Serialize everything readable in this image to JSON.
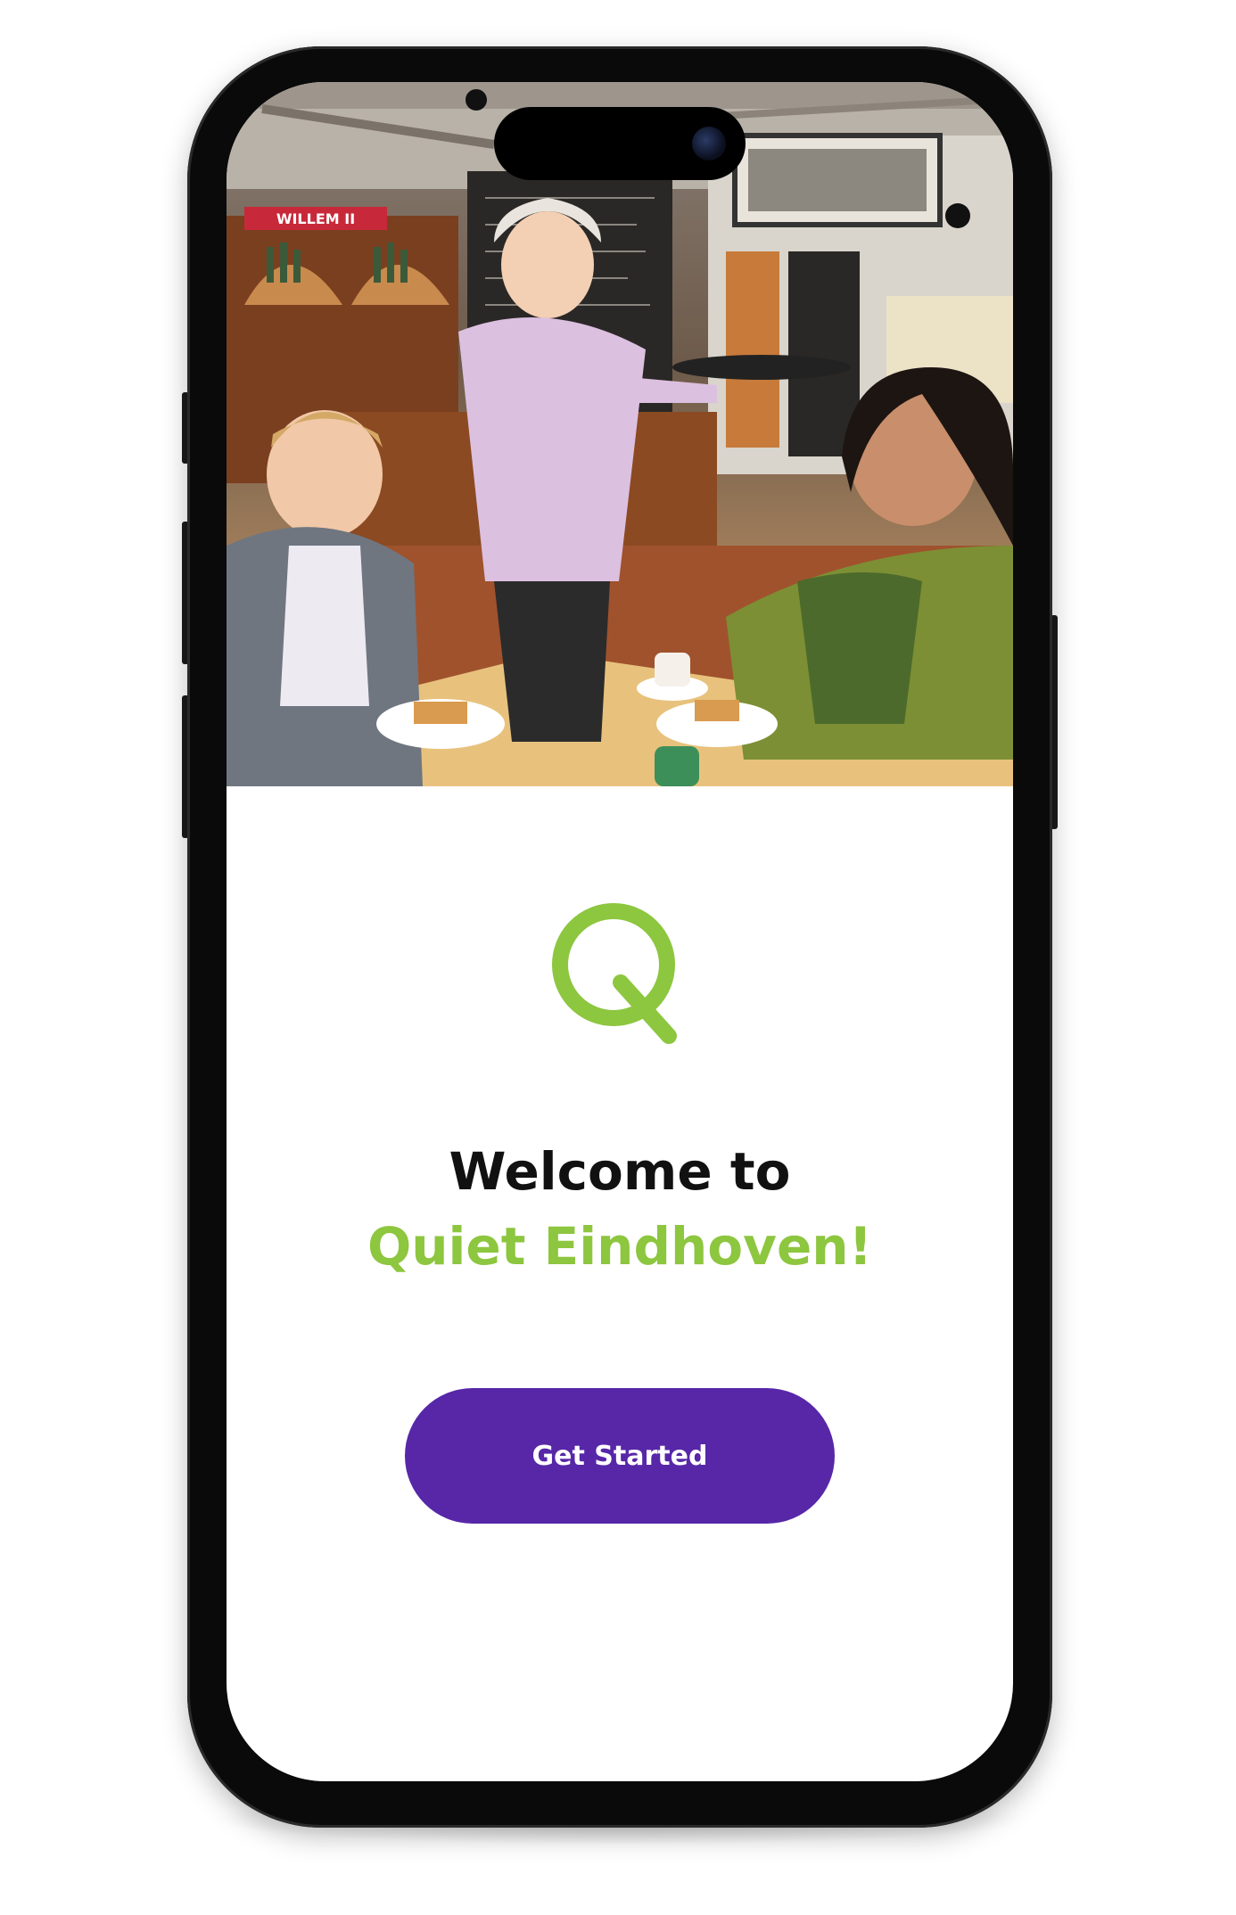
{
  "welcome": {
    "line1": "Welcome to",
    "line2": "Quiet Eindhoven!"
  },
  "hero": {
    "sign_text": "WILLEM II"
  },
  "cta": {
    "label": "Get Started"
  },
  "colors": {
    "brand_green": "#8dc63f",
    "button_purple": "#5727a8",
    "text_dark": "#111111",
    "device_frame": "#0a0a0a"
  },
  "icons": {
    "logo": "q-logo-icon",
    "camera": "front-camera-icon"
  }
}
